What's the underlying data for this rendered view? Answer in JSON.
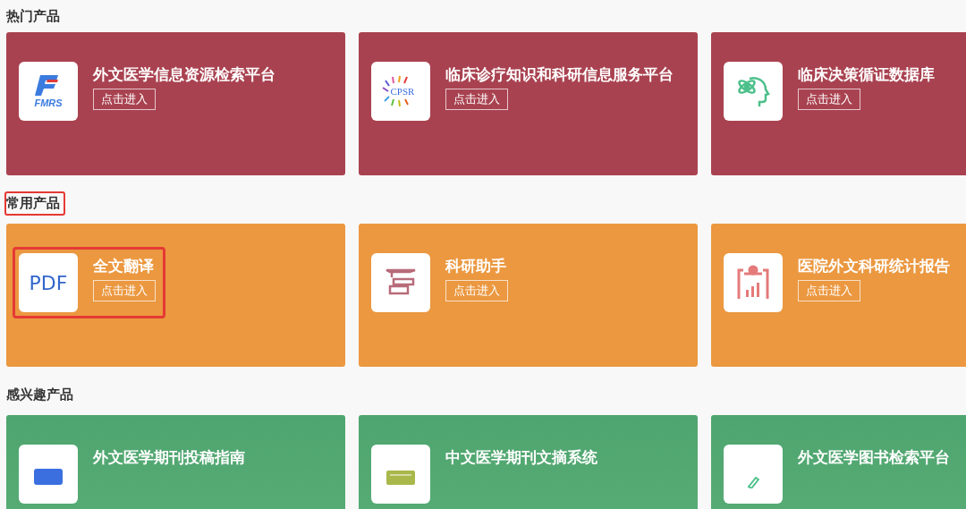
{
  "sections": [
    {
      "title": "热门产品",
      "highlighted": false,
      "color": "#a94250",
      "products": [
        {
          "name": "外文医学信息资源检索平台",
          "kind": "fmrs",
          "logo_text": "FMRS",
          "button": "点击进入",
          "highlighted": false
        },
        {
          "name": "临床诊疗知识和科研信息服务平台",
          "kind": "cpsr",
          "logo_text": "CPSR",
          "button": "点击进入",
          "highlighted": false
        },
        {
          "name": "临床决策循证数据库",
          "kind": "brain",
          "button": "点击进入",
          "highlighted": false
        }
      ]
    },
    {
      "title": "常用产品",
      "highlighted": true,
      "color": "#eb9840",
      "products": [
        {
          "name": "全文翻译",
          "kind": "pdf",
          "logo_text": "PDF",
          "button": "点击进入",
          "highlighted": true
        },
        {
          "name": "科研助手",
          "kind": "books",
          "button": "点击进入",
          "highlighted": false
        },
        {
          "name": "医院外文科研统计报告",
          "kind": "clipboard",
          "button": "点击进入",
          "highlighted": false
        }
      ]
    },
    {
      "title": "感兴趣产品",
      "highlighted": false,
      "color": "#4fa56f",
      "products": [
        {
          "name": "外文医学期刊投稿指南",
          "kind": "folder",
          "highlighted": false
        },
        {
          "name": "中文医学期刊文摘系统",
          "kind": "window",
          "highlighted": false
        },
        {
          "name": "外文医学图书检索平台",
          "kind": "pen",
          "highlighted": false
        }
      ]
    }
  ]
}
